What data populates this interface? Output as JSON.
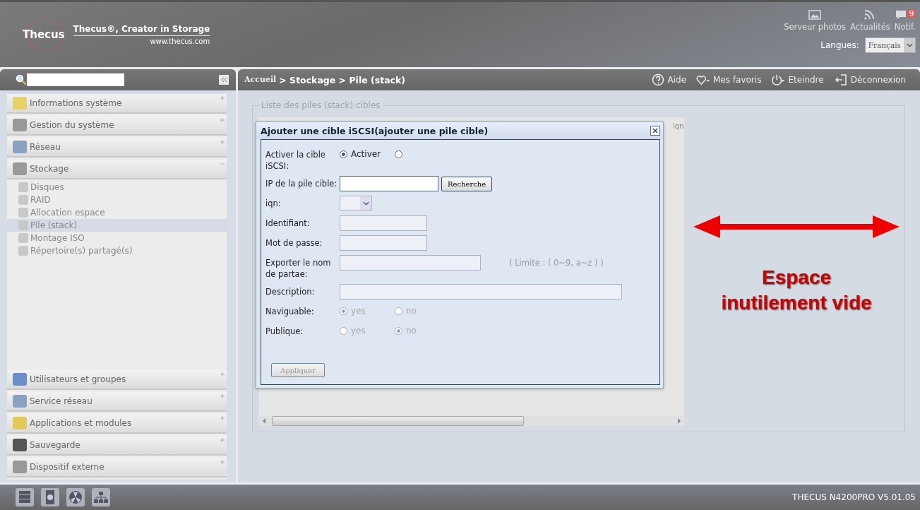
{
  "header": {
    "logo": "Thecus",
    "tagline": "Thecus®, Creator in Storage",
    "url": "www.thecus.com",
    "shortcuts": [
      {
        "kind": "photo",
        "label": "Serveur photos"
      },
      {
        "kind": "rss",
        "label": "Actualités"
      },
      {
        "kind": "notif",
        "label": "Notif.",
        "badge": "9"
      }
    ],
    "language_label": "Langues:",
    "language": "Français"
  },
  "sidebar": {
    "sections": [
      {
        "kind": "info",
        "label": "Informations système",
        "expanded": false
      },
      {
        "kind": "tools",
        "label": "Gestion du système",
        "expanded": false
      },
      {
        "kind": "network",
        "label": "Réseau",
        "expanded": false
      },
      {
        "kind": "storage",
        "label": "Stockage",
        "expanded": true,
        "children": [
          {
            "label": "Disques",
            "selected": false
          },
          {
            "label": "RAID",
            "selected": false
          },
          {
            "label": "Allocation espace",
            "selected": false
          },
          {
            "label": "Pile (stack)",
            "selected": true
          },
          {
            "label": "Montage ISO",
            "selected": false
          },
          {
            "label": "Répertoire(s) partagé(s)",
            "selected": false
          }
        ]
      },
      {
        "kind": "users",
        "label": "Utilisateurs et groupes",
        "expanded": false
      },
      {
        "kind": "network",
        "label": "Service réseau",
        "expanded": false
      },
      {
        "kind": "folder",
        "label": "Applications et modules",
        "expanded": false
      },
      {
        "kind": "save",
        "label": "Sauvegarde",
        "expanded": false
      },
      {
        "kind": "storage",
        "label": "Dispositif externe",
        "expanded": false
      }
    ]
  },
  "breadcrumb": {
    "home": "Accueil",
    "path": "> Stockage > Pile (stack)"
  },
  "actions": [
    {
      "kind": "help",
      "label": "Aide"
    },
    {
      "kind": "heart",
      "label": "Mes favoris"
    },
    {
      "kind": "power",
      "label": "Eteindre"
    },
    {
      "kind": "logout",
      "label": "Déconnexion"
    }
  ],
  "panel": {
    "legend": "Liste des piles (stack) cibles",
    "columns": [
      "iqn"
    ]
  },
  "dialog": {
    "title": "Ajouter une cible iSCSI(ajouter une pile cible)",
    "rows": [
      {
        "kind": "radio",
        "label": "Activer la cible iSCSI:",
        "disabled": false,
        "options": [
          {
            "label": "Activer",
            "selected": true
          },
          {
            "selected": false
          }
        ]
      },
      {
        "kind": "search",
        "label": "IP de la pile cible:",
        "button": "Recherche"
      },
      {
        "kind": "select",
        "label": "iqn:"
      },
      {
        "kind": "text",
        "label": "Identifiant:"
      },
      {
        "kind": "text",
        "label": "Mot de passe:"
      },
      {
        "kind": "hint",
        "label": "Exporter le nom de partae:",
        "hint": "( Limite : ( 0~9, a~z ) )"
      },
      {
        "kind": "long",
        "label": "Description:"
      },
      {
        "kind": "radio",
        "label": "Naviguable:",
        "disabled": true,
        "options": [
          {
            "label": "yes",
            "selected": true
          },
          {
            "label": "no",
            "selected": false
          }
        ]
      },
      {
        "kind": "radio",
        "label": "Publique:",
        "disabled": true,
        "options": [
          {
            "label": "yes",
            "selected": false
          },
          {
            "label": "no",
            "selected": true
          }
        ]
      }
    ],
    "apply": "Appliquer"
  },
  "annotation": {
    "text": "Espace inutilement vide"
  },
  "footer": {
    "version": "THECUS N4200PRO V5.01.05"
  }
}
